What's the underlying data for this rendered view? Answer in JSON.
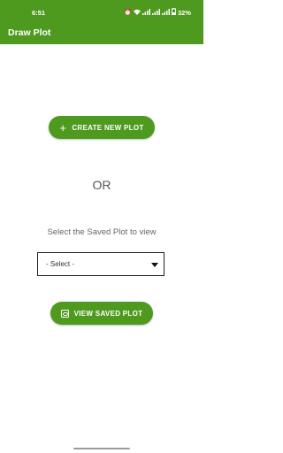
{
  "status_bar": {
    "time": "6:51",
    "battery": "32%"
  },
  "app_bar": {
    "title": "Draw Plot"
  },
  "main": {
    "create_button_label": "CREATE NEW PLOT",
    "or_label": "OR",
    "select_prompt": "Select the Saved Plot to view",
    "dropdown_selected": "- Select -",
    "view_button_label": "VIEW SAVED PLOT"
  },
  "icons": {
    "create": "plus-icon",
    "view": "view-icon",
    "dropdown": "dropdown-arrow-icon"
  },
  "colors": {
    "primary": "#4e9a1f",
    "on_primary": "#ffffff"
  }
}
